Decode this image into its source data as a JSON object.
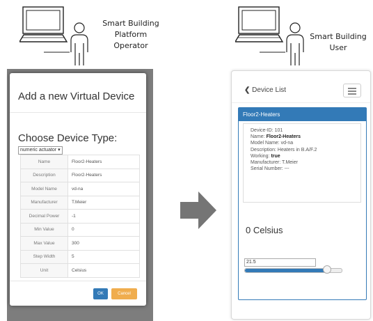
{
  "operator": {
    "label_lines": [
      "Smart Building",
      "Platform",
      "Operator"
    ]
  },
  "user": {
    "label_lines": [
      "Smart Building",
      "User"
    ]
  },
  "modal": {
    "title": "Add a new Virtual Device",
    "choose_label": "Choose Device Type:",
    "device_type": "numeric actuator",
    "fields": [
      {
        "label": "Name",
        "value": "Floor2-Heaters"
      },
      {
        "label": "Description",
        "value": "Floor2-Heaters"
      },
      {
        "label": "Model Name",
        "value": "vd-na"
      },
      {
        "label": "Manufacturer",
        "value": "T.Meier"
      },
      {
        "label": "Decimal Power",
        "value": "-1"
      },
      {
        "label": "Min Value",
        "value": "0"
      },
      {
        "label": "Max Value",
        "value": "300"
      },
      {
        "label": "Step Width",
        "value": "5"
      },
      {
        "label": "Unit",
        "value": "Celsius"
      }
    ],
    "ok_label": "OK",
    "cancel_label": "Cancel"
  },
  "app": {
    "nav_back_label": "Device List",
    "device_header": "Floor2-Heaters",
    "info": [
      {
        "key": "Device-ID:",
        "value": "101",
        "bold": false
      },
      {
        "key": "Name:",
        "value": "Floor2-Heaters",
        "bold": true
      },
      {
        "key": "Model Name:",
        "value": "vd-na",
        "bold": false
      },
      {
        "key": "Description:",
        "value": "Heaters in B.A/F.2",
        "bold": false
      },
      {
        "key": "Working:",
        "value": "true",
        "bold": true
      },
      {
        "key": "Manufacturer:",
        "value": "T.Meier",
        "bold": false
      },
      {
        "key": "Serial Number:",
        "value": "---",
        "bold": false
      }
    ],
    "current_value": "0 Celsius",
    "input_value": "21.5",
    "slider_fraction": 0.85
  },
  "colors": {
    "primary": "#337ab7",
    "cancel": "#f0ad4e",
    "arrow": "#757575",
    "backdrop": "#7d7d7d"
  }
}
